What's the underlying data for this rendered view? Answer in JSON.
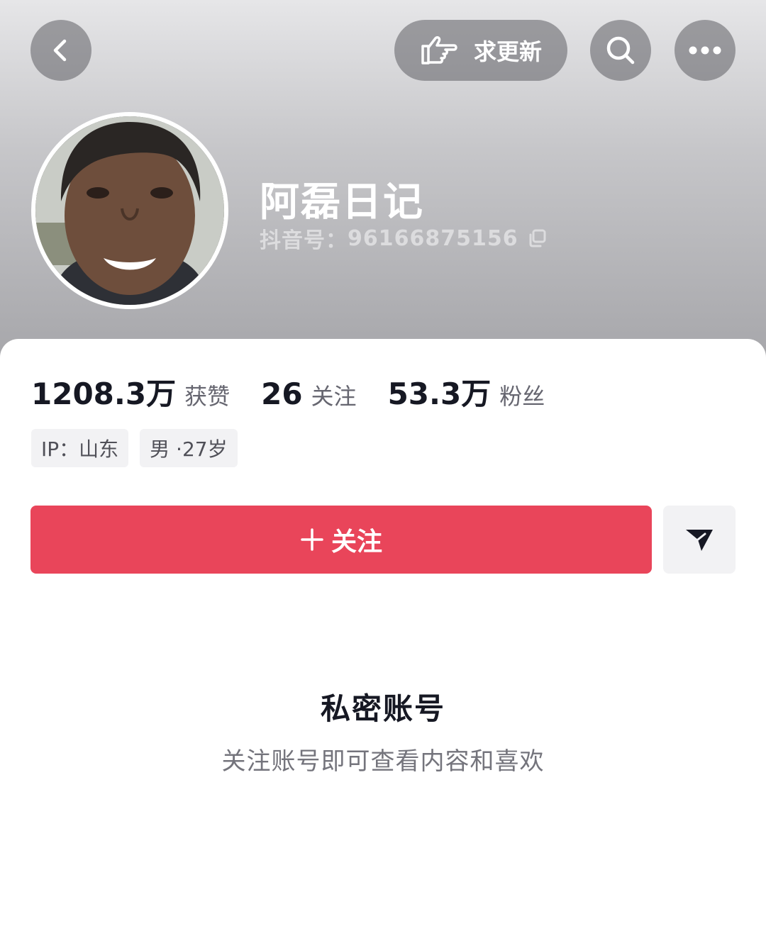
{
  "header": {
    "back_icon": "chevron-left-icon",
    "request_update": {
      "icon": "pointing-hand-icon",
      "label": "求更新"
    },
    "search_icon": "search-icon",
    "more_icon": "more-dots-icon"
  },
  "profile": {
    "name": "阿磊日记",
    "douyin_id_label": "抖音号：",
    "douyin_id": "96166875156",
    "copy_icon": "copy-icon"
  },
  "stats": [
    {
      "value": "1208.3万",
      "label": "获赞"
    },
    {
      "value": "26",
      "label": "关注"
    },
    {
      "value": "53.3万",
      "label": "粉丝"
    }
  ],
  "tags": [
    {
      "text": "IP：山东"
    },
    {
      "text": "男 ·27岁"
    }
  ],
  "actions": {
    "follow_icon": "plus-icon",
    "follow_label": "关注",
    "share_icon": "send-icon"
  },
  "private": {
    "title": "私密账号",
    "subtitle": "关注账号即可查看内容和喜欢"
  },
  "colors": {
    "accent": "#e9455a",
    "text_primary": "#161823",
    "text_secondary": "#74747c",
    "tag_background": "#f2f2f4"
  }
}
